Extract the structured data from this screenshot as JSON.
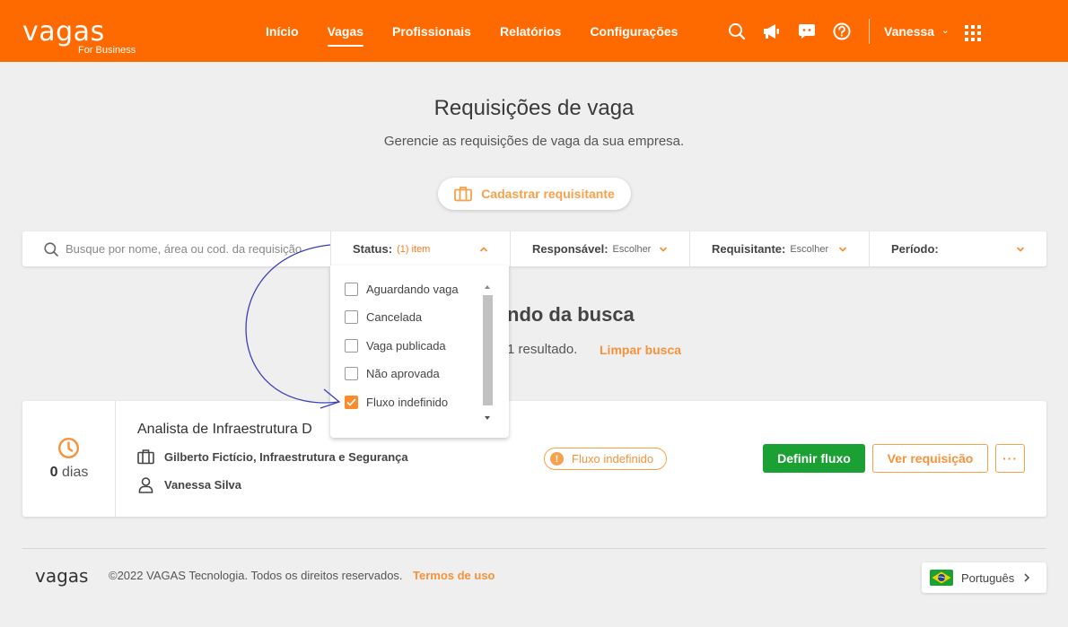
{
  "header": {
    "logo_text": "vagas",
    "logo_sub": "For Business",
    "nav": [
      {
        "label": "Início",
        "active": false
      },
      {
        "label": "Vagas",
        "active": true
      },
      {
        "label": "Profissionais",
        "active": false
      },
      {
        "label": "Relatórios",
        "active": false
      },
      {
        "label": "Configurações",
        "active": false
      }
    ],
    "user_name": "Vanessa",
    "icons": [
      "search-icon",
      "megaphone-icon",
      "chat-icon",
      "help-icon",
      "apps-grid-icon"
    ]
  },
  "page": {
    "title": "Requisições de vaga",
    "subtitle": "Gerencie as requisições de vaga da sua empresa.",
    "add_button": "Cadastrar requisitante"
  },
  "filters": {
    "search_placeholder": "Busque por nome, área ou cod. da requisição",
    "status_label": "Status:",
    "status_count": "(1) item",
    "responsavel_label": "Responsável:",
    "responsavel_value": "Escolher",
    "requisitante_label": "Requisitante:",
    "requisitante_value": "Escolher",
    "periodo_label": "Período:"
  },
  "status_dropdown": {
    "options": [
      {
        "label": "Aguardando vaga",
        "checked": false
      },
      {
        "label": "Cancelada",
        "checked": false
      },
      {
        "label": "Vaga publicada",
        "checked": false
      },
      {
        "label": "Não aprovada",
        "checked": false
      },
      {
        "label": "Fluxo indefinido",
        "checked": true
      }
    ]
  },
  "results": {
    "title": "ndo da busca",
    "count": "1 resultado.",
    "clear_link": "Limpar busca"
  },
  "card": {
    "days_number": "0",
    "days_unit": "dias",
    "job_title": "Analista de Infraestrutura D",
    "company": "Gilberto Fictício, Infraestrutura e Segurança",
    "person": "Vanessa Silva",
    "status": "Fluxo indefinido",
    "define_button": "Definir fluxo",
    "view_button": "Ver requisição",
    "more_button": "···"
  },
  "footer": {
    "logo": "vagas",
    "copyright": "©2022 VAGAS Tecnologia. Todos os direitos reservados.",
    "terms": "Termos de uso",
    "language": "Português"
  },
  "colors": {
    "brand": "#ff6a00",
    "accent": "#f7923a",
    "success": "#1aa033",
    "background": "#efefef"
  }
}
